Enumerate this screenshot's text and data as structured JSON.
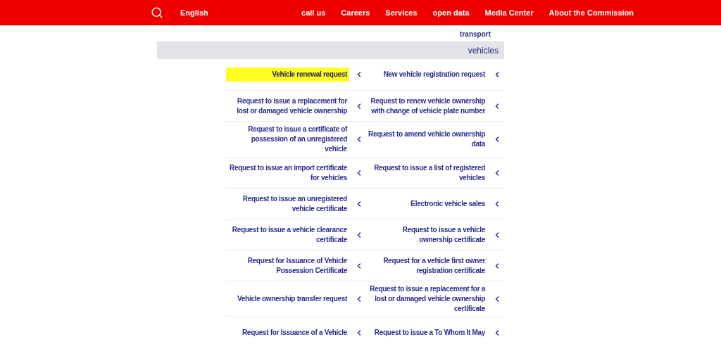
{
  "header": {
    "language": "English",
    "nav": [
      "call us",
      "Careers",
      "Services",
      "open data",
      "Media Center",
      "About the Commission"
    ]
  },
  "previous_row": [
    "transport"
  ],
  "section": {
    "title": "vehicles",
    "items": [
      {
        "left": {
          "label": "Vehicle renewal request",
          "highlighted": true
        },
        "right": {
          "label": "New vehicle registration request",
          "highlighted": false
        }
      },
      {
        "left": {
          "label": "Request to issue a replacement for lost or damaged vehicle ownership",
          "highlighted": false
        },
        "right": {
          "label": "Request to renew vehicle ownership with change of vehicle plate number",
          "highlighted": false
        }
      },
      {
        "left": {
          "label": "Request to issue a certificate of possession of an unregistered vehicle",
          "highlighted": false
        },
        "right": {
          "label": "Request to amend vehicle ownership data",
          "highlighted": false
        }
      },
      {
        "left": {
          "label": "Request to issue an import certificate for vehicles",
          "highlighted": false
        },
        "right": {
          "label": "Request to issue a list of registered vehicles",
          "highlighted": false
        }
      },
      {
        "left": {
          "label": "Request to issue an unregistered vehicle certificate",
          "highlighted": false
        },
        "right": {
          "label": "Electronic vehicle sales",
          "highlighted": false
        }
      },
      {
        "left": {
          "label": "Request to issue a vehicle clearance certificate",
          "highlighted": false
        },
        "right": {
          "label": "Request to issue a vehicle ownership certificate",
          "highlighted": false
        }
      },
      {
        "left": {
          "label": "Request for Issuance of Vehicle Possession Certificate",
          "highlighted": false
        },
        "right": {
          "label": "Request for a vehicle first owner registration certificate",
          "highlighted": false
        }
      },
      {
        "left": {
          "label": "Vehicle ownership transfer request",
          "highlighted": false
        },
        "right": {
          "label": "Request to issue a replacement for a lost or damaged vehicle ownership certificate",
          "highlighted": false
        }
      },
      {
        "left": {
          "label": "Request for Issuance of a Vehicle",
          "highlighted": false
        },
        "right": {
          "label": "Request to issue a To Whom It May",
          "highlighted": false
        }
      }
    ]
  }
}
